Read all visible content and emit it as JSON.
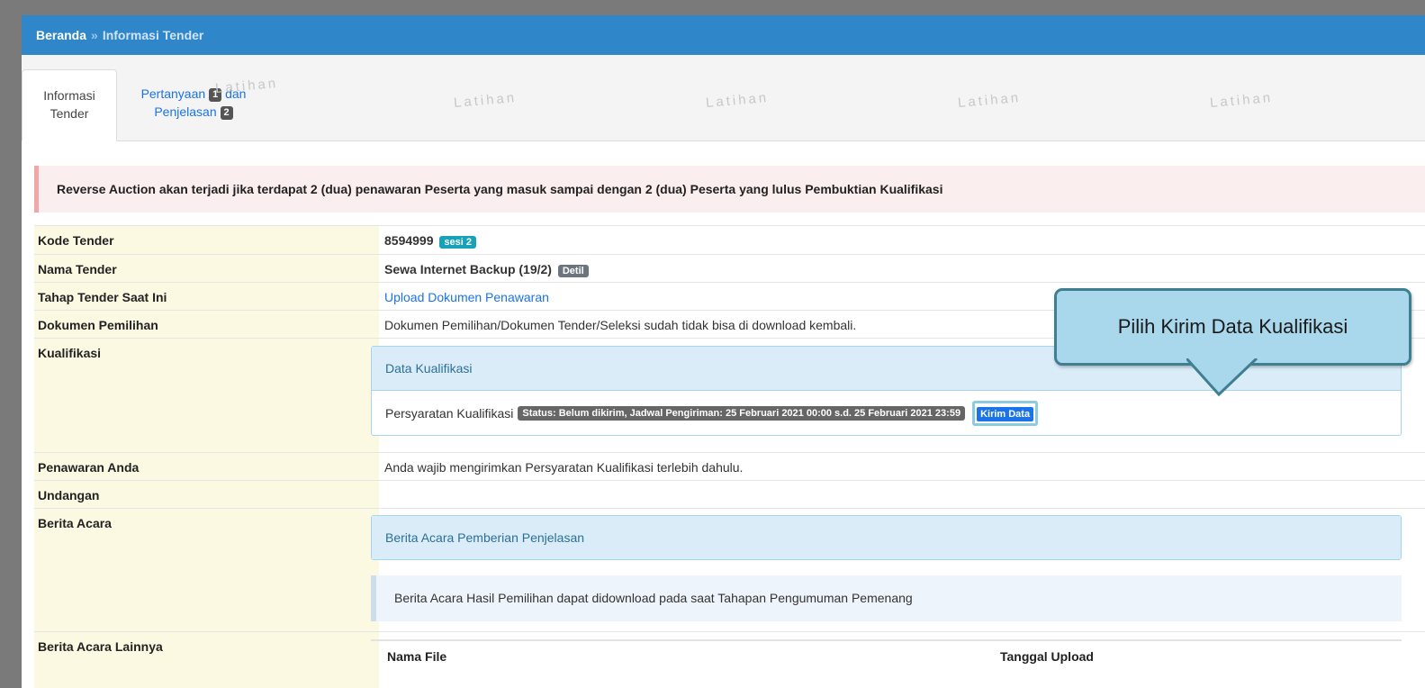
{
  "breadcrumb": {
    "home": "Beranda",
    "separator": "»",
    "current": "Informasi Tender"
  },
  "tabs": {
    "active_line1": "Informasi",
    "active_line2": "Tender",
    "second_text1": "Pertanyaan",
    "second_badge1": "1",
    "second_text2": "dan",
    "second_text3": "Penjelasan",
    "second_badge2": "2"
  },
  "watermark": "Latihan",
  "alert": "Reverse Auction akan terjadi jika terdapat 2 (dua) penawaran Peserta yang masuk sampai dengan 2 (dua) Peserta yang lulus Pembuktian Kualifikasi",
  "rows": {
    "kode": {
      "label": "Kode Tender",
      "value": "8594999",
      "badge": "sesi 2"
    },
    "nama": {
      "label": "Nama Tender",
      "value": "Sewa Internet Backup (19/2)",
      "badge": "Detil"
    },
    "tahap": {
      "label": "Tahap Tender Saat Ini",
      "value": "Upload Dokumen Penawaran"
    },
    "dokumen": {
      "label": "Dokumen Pemilihan",
      "value": "Dokumen Pemilihan/Dokumen Tender/Seleksi sudah tidak bisa di download kembali."
    },
    "kualifikasi": {
      "label": "Kualifikasi",
      "panel_title": "Data Kualifikasi",
      "item_label": "Persyaratan Kualifikasi",
      "status": "Status: Belum dikirim, Jadwal Pengiriman: 25 Februari 2021 00:00 s.d. 25 Februari 2021 23:59",
      "button": "Kirim Data"
    },
    "penawaran": {
      "label": "Penawaran Anda",
      "value": "Anda wajib mengirimkan Persyaratan Kualifikasi terlebih dahulu."
    },
    "undangan": {
      "label": "Undangan",
      "value": ""
    },
    "berita_acara": {
      "label": "Berita Acara",
      "panel_title": "Berita Acara Pemberian Penjelasan",
      "info": "Berita Acara Hasil Pemilihan dapat didownload pada saat Tahapan Pengumuman Pemenang"
    },
    "lainnya": {
      "label": "Berita Acara Lainnya",
      "col1": "Nama File",
      "col2": "Tanggal Upload"
    }
  },
  "callout": "Pilih Kirim Data Kualifikasi"
}
